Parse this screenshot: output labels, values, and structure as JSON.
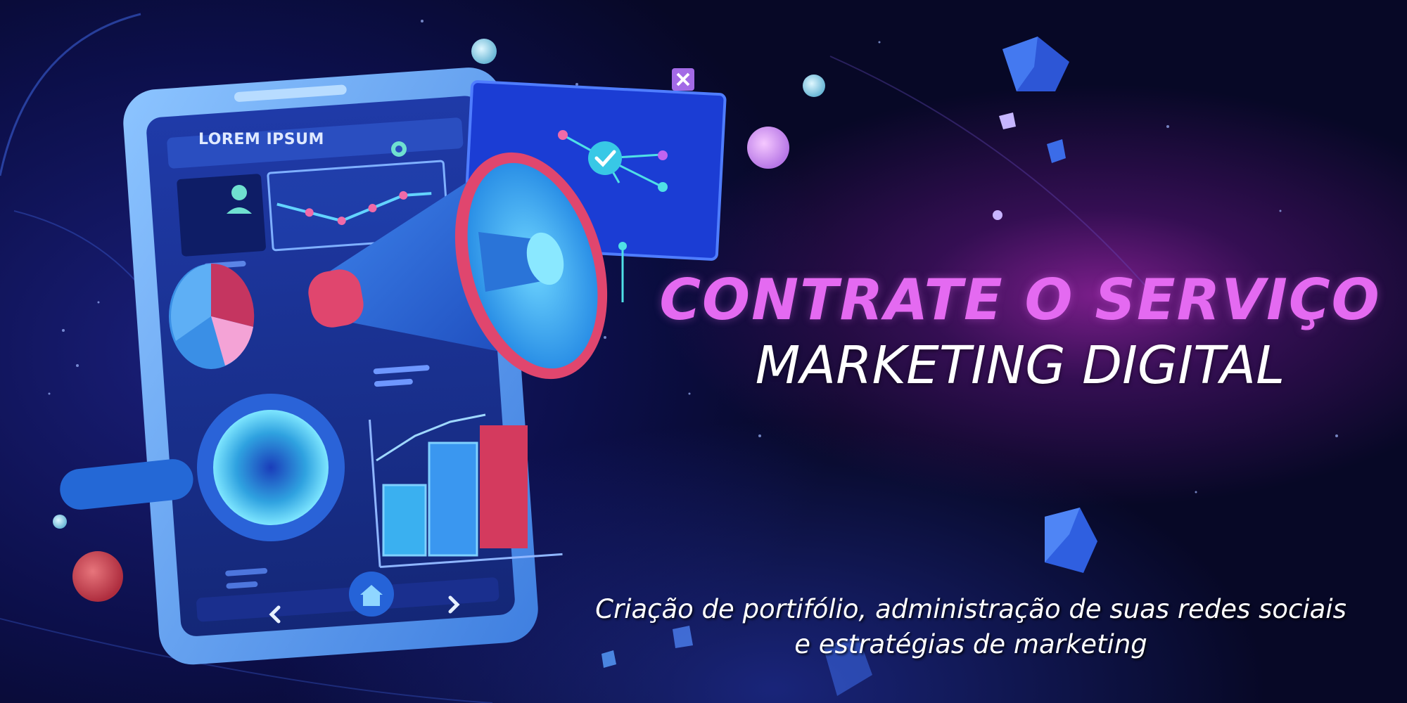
{
  "headline": {
    "line1": "CONTRATE O SERVIÇO",
    "line2": "MARKETING DIGITAL"
  },
  "tagline": {
    "line1": "Criação de portifólio, administração de suas redes sociais",
    "line2": "e estratégias de marketing"
  },
  "phone_screen": {
    "title": "LOREM IPSUM"
  },
  "colors": {
    "background": "#0a0c3a",
    "headline_accent": "#e46af1",
    "phone_frame": "#5aa2ee",
    "megaphone_rim": "#e0466e"
  },
  "icons": [
    "user-icon",
    "gear-icon",
    "checkmark-icon",
    "close-icon",
    "home-icon",
    "chevron-left-icon",
    "chevron-right-icon",
    "megaphone-icon",
    "magnifier-icon",
    "pie-chart-icon",
    "bar-chart-icon"
  ]
}
